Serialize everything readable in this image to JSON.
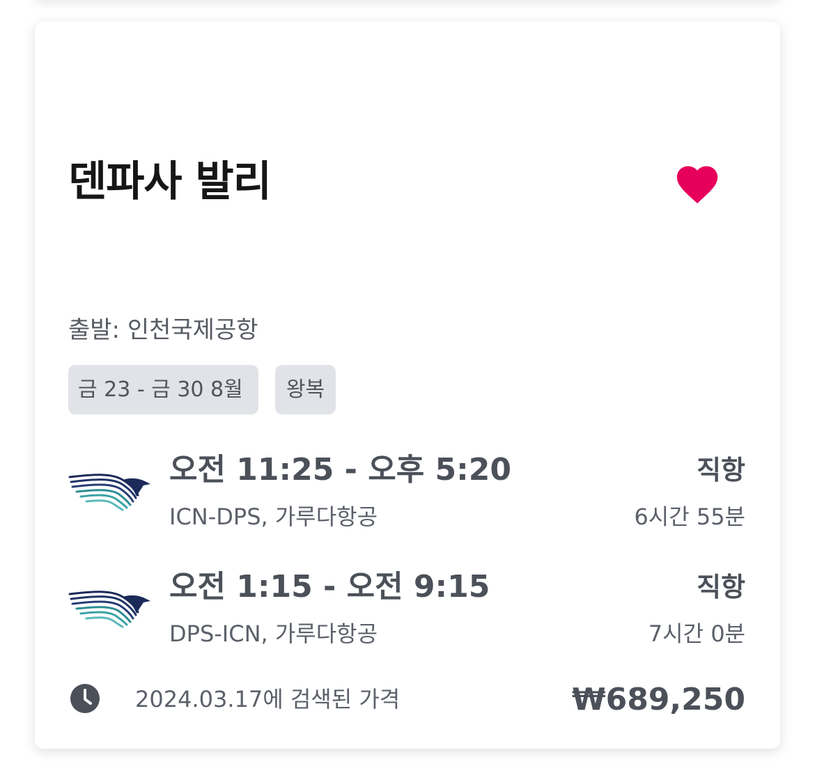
{
  "card": {
    "title": "덴파사 발리",
    "favorite_icon": "heart-icon",
    "favorite_color": "#e6005c",
    "departure": "출발: 인천국제공항",
    "dates_chip": "금 23 - 금 30 8월",
    "trip_type_chip": "왕복",
    "legs": [
      {
        "time": "오전 11:25 - 오후 5:20",
        "route": "ICN-DPS, 가루다항공",
        "stops": "직항",
        "duration": "6시간 55분",
        "airline_logo": "garuda-indonesia-logo"
      },
      {
        "time": "오전 1:15 - 오전 9:15",
        "route": "DPS-ICN, 가루다항공",
        "stops": "직항",
        "duration": "7시간 0분",
        "airline_logo": "garuda-indonesia-logo"
      }
    ],
    "price_note_icon": "clock-icon",
    "price_note": "2024.03.17에 검색된 가격",
    "price": "₩689,250"
  }
}
